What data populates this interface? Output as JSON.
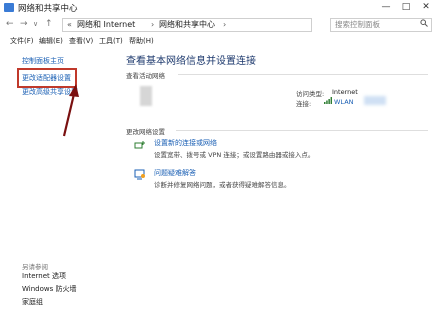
{
  "window": {
    "title": "网络和共享中心",
    "controls": [
      "—",
      "□",
      "✕"
    ]
  },
  "address": {
    "back": "←",
    "forward": "→",
    "up": "↑",
    "dropdown": "∨",
    "segments": [
      "«",
      "网络和 Internet",
      "›",
      "网络和共享中心",
      "›"
    ],
    "search_placeholder": "搜索控制面板"
  },
  "menubar": {
    "items": [
      "文件(F)",
      "编辑(E)",
      "查看(V)",
      "工具(T)",
      "帮助(H)"
    ]
  },
  "sidebar": {
    "home": "控制面板主页",
    "items": [
      "更改适配器设置",
      "更改高级共享设置"
    ],
    "see_also_title": "另请参阅",
    "see_also": [
      "Internet 选项",
      "Windows 防火墙",
      "家庭组"
    ]
  },
  "main": {
    "title": "查看基本网络信息并设置连接",
    "active_networks_label": "查看活动网络",
    "access_type_label": "访问类型:",
    "access_type_value": "Internet",
    "connection_label": "连接:",
    "connection_value": "WLAN",
    "change_settings_label": "更改网络设置",
    "tasks": [
      {
        "link": "设置新的连接或网络",
        "desc": "设置宽带、拨号或 VPN 连接；或设置路由器或接入点。"
      },
      {
        "link": "问题疑难解答",
        "desc": "诊断并修复网络问题，或者获得疑难解答信息。"
      }
    ]
  },
  "colors": {
    "highlight": "#c0392b",
    "link": "#1a5fb4",
    "title": "#1e3a6e"
  },
  "icons": {
    "app": "network-icon",
    "wifi": "wifi-signal-icon",
    "task1": "new-connection-icon",
    "task2": "troubleshoot-icon",
    "search": "search-icon"
  }
}
